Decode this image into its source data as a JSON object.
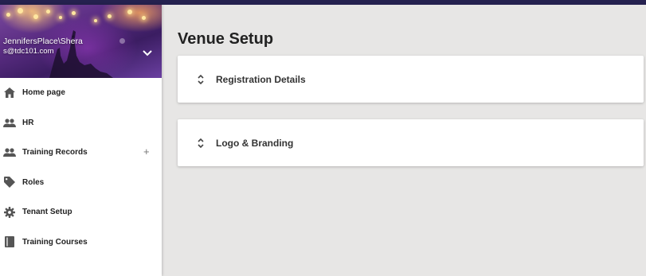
{
  "profile": {
    "user_name": "JennifersPlace\\Shera",
    "user_email": "s@tdc101.com",
    "dropdown_icon": "chevron-down-icon"
  },
  "nav": {
    "items": [
      {
        "label": "Home page",
        "icon": "home-icon"
      },
      {
        "label": "HR",
        "icon": "people-icon"
      },
      {
        "label": "Training Records",
        "icon": "people-icon",
        "expand": "+"
      },
      {
        "label": "Roles",
        "icon": "tag-icon"
      },
      {
        "label": "Tenant Setup",
        "icon": "gear-icon"
      },
      {
        "label": "Training Courses",
        "icon": "book-icon"
      }
    ]
  },
  "main": {
    "title": "Venue Setup",
    "sections": [
      {
        "title": "Registration Details",
        "icon": "expand-icon"
      },
      {
        "title": "Logo & Branding",
        "icon": "expand-icon"
      }
    ]
  },
  "colors": {
    "topbar": "#25214f",
    "background": "#e7e6e5",
    "icon": "#555555"
  }
}
